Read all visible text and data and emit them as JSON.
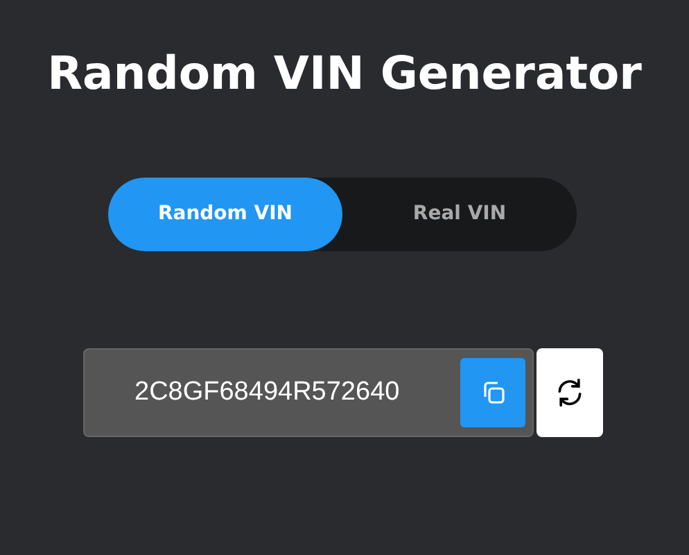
{
  "title": "Random VIN Generator",
  "tabs": [
    {
      "label": "Random VIN",
      "selected": true
    },
    {
      "label": "Real VIN",
      "selected": false
    }
  ],
  "vin": {
    "value": "2C8GF68494R572640"
  }
}
